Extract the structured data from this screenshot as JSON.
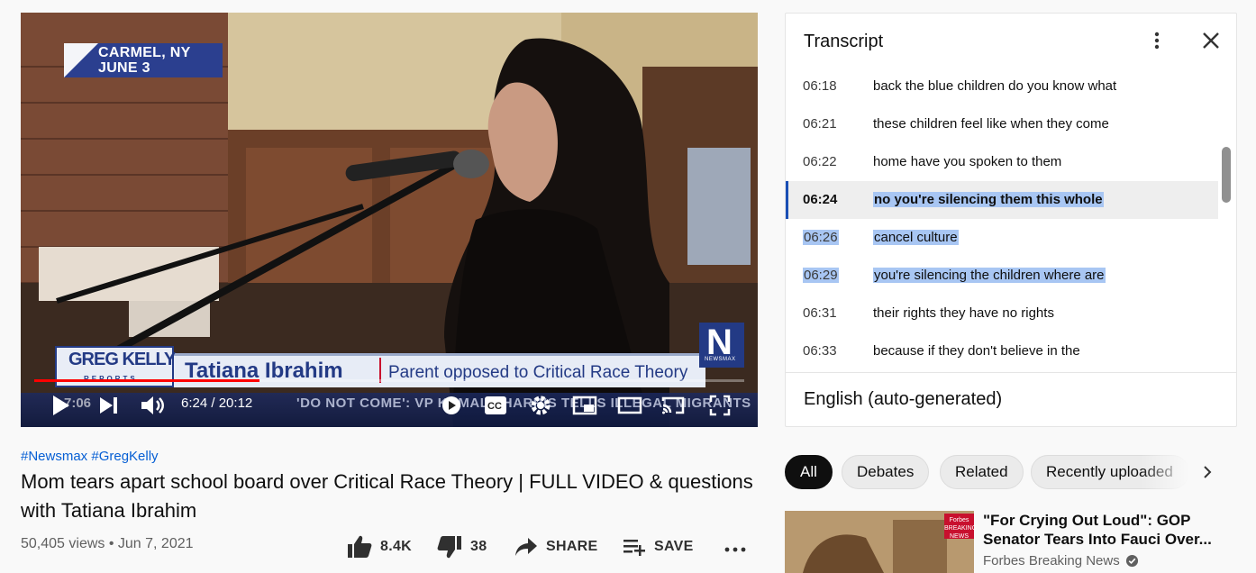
{
  "video": {
    "location_line1": "CARMEL, NY",
    "location_line2": "JUNE 3",
    "show_logo": "GREG KELLY",
    "show_logo_sub": "REPORTS",
    "lower_third_name": "Tatiana Ibrahim",
    "lower_third_role": "Parent opposed to Critical Race Theory",
    "network_logo": "N",
    "network_logo_sub": "NEWSMAX",
    "ticker_text": "'DO NOT COME': VP KAMALA HARRIS TELLS ILLEGAL MIGRANTS",
    "ticker_time": "7:06",
    "current_time": "6:24",
    "duration": "20:12",
    "progress_fraction": 0.317
  },
  "transcript": {
    "title": "Transcript",
    "language": "English (auto-generated)",
    "segments": [
      {
        "time": "06:18",
        "text": "back the blue children do you know what",
        "state": "normal"
      },
      {
        "time": "06:21",
        "text": "these children feel like when they come",
        "state": "normal"
      },
      {
        "time": "06:22",
        "text": "home have you spoken to them",
        "state": "normal"
      },
      {
        "time": "06:24",
        "text": "no you're silencing them this whole",
        "state": "active"
      },
      {
        "time": "06:26",
        "text": "cancel culture",
        "state": "selected"
      },
      {
        "time": "06:29",
        "text": "you're silencing the children where are",
        "state": "selected"
      },
      {
        "time": "06:31",
        "text": "their rights they have no rights",
        "state": "normal"
      },
      {
        "time": "06:33",
        "text": "because if they don't believe in the",
        "state": "normal"
      }
    ]
  },
  "info": {
    "hashtags": "#Newsmax #GregKelly",
    "title": "Mom tears apart school board over Critical Race Theory | FULL VIDEO & questions with Tatiana Ibrahim",
    "views": "50,405 views",
    "date": "Jun 7, 2021",
    "likes": "8.4K",
    "dislikes": "38",
    "share_label": "SHARE",
    "save_label": "SAVE"
  },
  "chips": [
    "All",
    "Debates",
    "Related",
    "Recently uploaded"
  ],
  "recommendation": {
    "title_line1": "\"For Crying Out Loud\": GOP",
    "title_line2": "Senator Tears Into Fauci Over...",
    "channel": "Forbes Breaking News",
    "badge": "Forbes BREAKING NEWS"
  },
  "colors": {
    "accent_blue": "#065fd4",
    "progress_red": "#ff0000",
    "selection": "#a8c6f3",
    "active_border": "#1a4fb5"
  }
}
